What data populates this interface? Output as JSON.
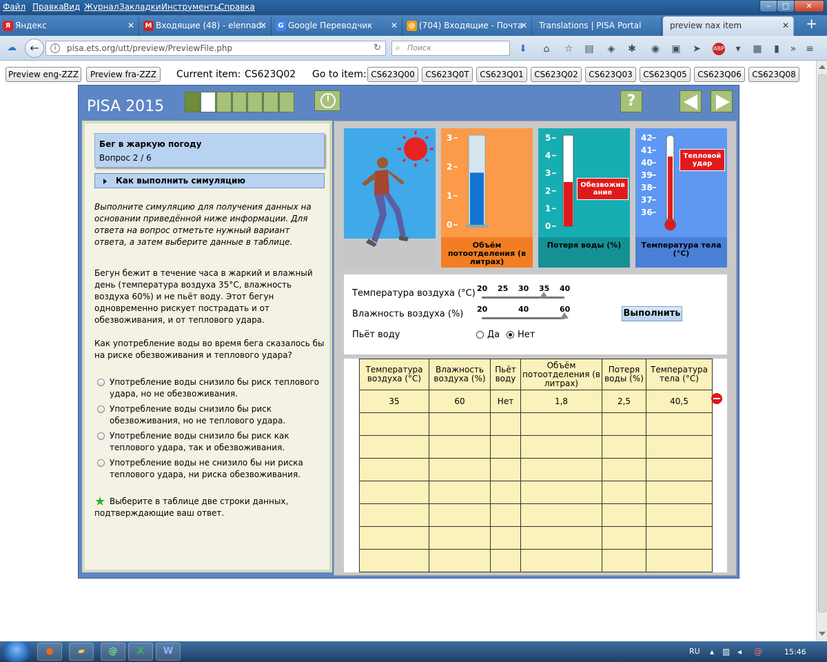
{
  "menubar": {
    "items": [
      "Файл",
      "Правка",
      "Вид",
      "Журнал",
      "Закладки",
      "Инструменты",
      "Справка"
    ]
  },
  "tabs": [
    {
      "title": "Яндекс",
      "favicon": "Я",
      "color": "#e02020"
    },
    {
      "title": "Входящие (48) - elennad...",
      "favicon": "M",
      "color": "#c62828"
    },
    {
      "title": "Google Переводчик",
      "favicon": "G",
      "color": "#4285f4"
    },
    {
      "title": "(704) Входящие - Почта ...",
      "favicon": "@",
      "color": "#f39c12"
    },
    {
      "title": "Translations | PISA Portal",
      "favicon": "",
      "color": "#3a6ea5"
    },
    {
      "title": "preview nax item",
      "favicon": "",
      "color": "#3a6ea5"
    }
  ],
  "navbar": {
    "url": "pisa.ets.org/utt/preview/PreviewFile.php",
    "search_placeholder": "Поиск"
  },
  "preview_bar": {
    "preview_eng": "Preview eng-ZZZ",
    "preview_fra": "Preview fra-ZZZ",
    "current_item_label": "Current item:",
    "current_item_value": "CS623Q02",
    "goto_label": "Go to item:",
    "items": [
      "CS623Q00",
      "CS623Q0T",
      "CS623Q01",
      "CS623Q02",
      "CS623Q03",
      "CS623Q05",
      "CS623Q06",
      "CS623Q08"
    ]
  },
  "pisa": {
    "title": "PISA 2015",
    "progress_total": 7,
    "progress_current": 2,
    "help_symbol": "?"
  },
  "left": {
    "unit_title": "Бег в жаркую погоду",
    "question_number": "Вопрос 2 / 6",
    "howto": "Как выполнить симуляцию",
    "instructions": "Выполните симуляцию для получения данных на основании приведённой ниже информации. Для ответа на вопрос отметьте нужный вариант ответа, а затем выберите данные в таблице.",
    "scenario": "Бегун бежит в течение часа в жаркий и влажный день (температура воздуха 35°C, влажность воздуха 60%) и не пьёт воду. Этот бегун одновременно рискует пострадать и от обезвоживания, и от теплового удара.",
    "question": "Как употребление воды во время бега сказалось бы на риске обезвоживания и теплового удара?",
    "options": [
      "Употребление воды снизило бы риск теплового удара, но не обезвоживания.",
      "Употребление воды снизило бы риск обезвоживания, но не теплового удара.",
      "Употребление воды снизило бы риск как теплового удара, так и обезвоживания.",
      "Употребление воды не снизило бы ни риска теплового удара, ни риска обезвоживания."
    ],
    "table_instruction": "Выберите в таблице две строки данных, подтверждающие ваш ответ."
  },
  "sim": {
    "sweat": {
      "label": "Объём потоотделения (в литрах)",
      "ticks": [
        "0",
        "1",
        "2",
        "3"
      ],
      "value": 1.8,
      "max": 3
    },
    "water": {
      "label": "Потеря воды (%)",
      "ticks": [
        "0",
        "1",
        "2",
        "3",
        "4",
        "5"
      ],
      "value": 2.5,
      "max": 5,
      "warning": "Обезвожив ание"
    },
    "temp": {
      "label": "Температура тела (°C)",
      "ticks": [
        "36",
        "37",
        "38",
        "39",
        "40",
        "41",
        "42"
      ],
      "value": 40.5,
      "min": 35.5,
      "max": 42,
      "warning": "Тепловой удар"
    }
  },
  "controls": {
    "air_temp_label": "Температура воздуха (°C)",
    "air_temp_ticks": [
      "20",
      "25",
      "30",
      "35",
      "40"
    ],
    "air_temp_value": 35,
    "humidity_label": "Влажность воздуха (%)",
    "humidity_ticks": [
      "20",
      "40",
      "60"
    ],
    "humidity_value": 60,
    "drink_label": "Пьёт воду",
    "drink_yes": "Да",
    "drink_no": "Нет",
    "drink_value": "Нет",
    "run_button": "Выполнить"
  },
  "table": {
    "headers": [
      "Температура воздуха (°C)",
      "Влажность воздуха (%)",
      "Пьёт воду",
      "Объём потоотделения (в литрах)",
      "Потеря воды (%)",
      "Температура тела (°C)"
    ],
    "rows": [
      [
        "35",
        "60",
        "Нет",
        "1,8",
        "2,5",
        "40,5"
      ]
    ],
    "empty_rows": 7
  },
  "taskbar": {
    "lang": "RU",
    "time": "15:46"
  }
}
